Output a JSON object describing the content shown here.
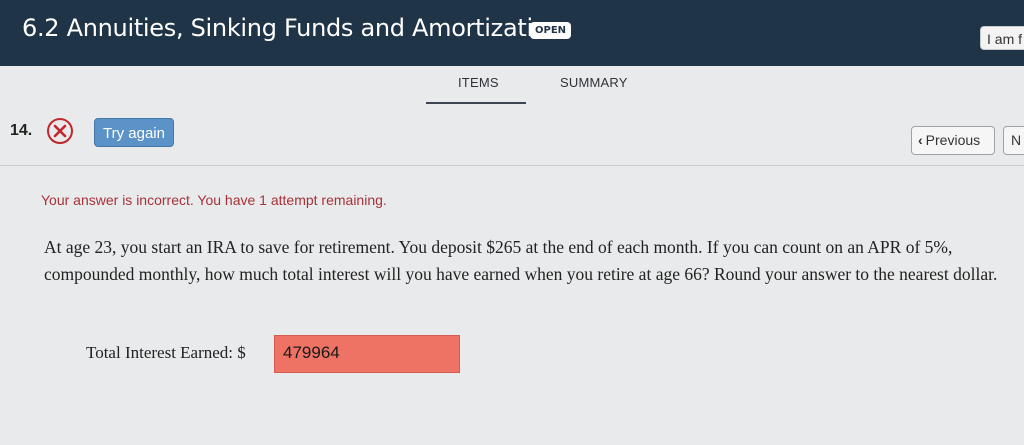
{
  "header": {
    "title": "6.2 Annuities, Sinking Funds and Amortization",
    "badge": "OPEN",
    "user_button": "I am f"
  },
  "tabs": [
    {
      "label": "ITEMS",
      "active": true
    },
    {
      "label": "SUMMARY",
      "active": false
    }
  ],
  "question_bar": {
    "number": "14.",
    "status_icon": "x-circle-icon",
    "try_again": "Try again",
    "previous": "Previous",
    "next": "N"
  },
  "feedback": "Your answer is incorrect. You have 1 attempt remaining.",
  "question_text": "At age 23, you start an IRA to save for retirement. You deposit $265 at the end of each month. If you can count on an APR of 5%, compounded monthly, how much total interest will you have earned when you retire at age 66? Round your answer to the nearest dollar.",
  "answer": {
    "label": "Total Interest Earned: $",
    "value": "479964"
  },
  "colors": {
    "header_bg": "#1f3447",
    "incorrect": "#c0282d",
    "button_blue": "#5b93c8",
    "answer_incorrect_bg": "#ee7364"
  }
}
